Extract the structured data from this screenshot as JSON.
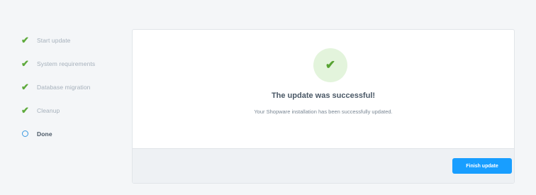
{
  "steps": [
    {
      "label": "Start update",
      "status": "done",
      "icon": "check-icon"
    },
    {
      "label": "System requirements",
      "status": "done",
      "icon": "check-icon"
    },
    {
      "label": "Database migration",
      "status": "done",
      "icon": "check-icon"
    },
    {
      "label": "Cleanup",
      "status": "done",
      "icon": "check-icon"
    },
    {
      "label": "Done",
      "status": "current",
      "icon": "circle-icon"
    }
  ],
  "card": {
    "icon": "check-icon",
    "title": "The update was successful!",
    "message": "Your Shopware installation has been successfully updated.",
    "finish_button_label": "Finish update"
  },
  "colors": {
    "accent": "#189eff",
    "success": "#57a332",
    "success_bg": "#e3f4dc",
    "current_step": "#3a99e0"
  }
}
